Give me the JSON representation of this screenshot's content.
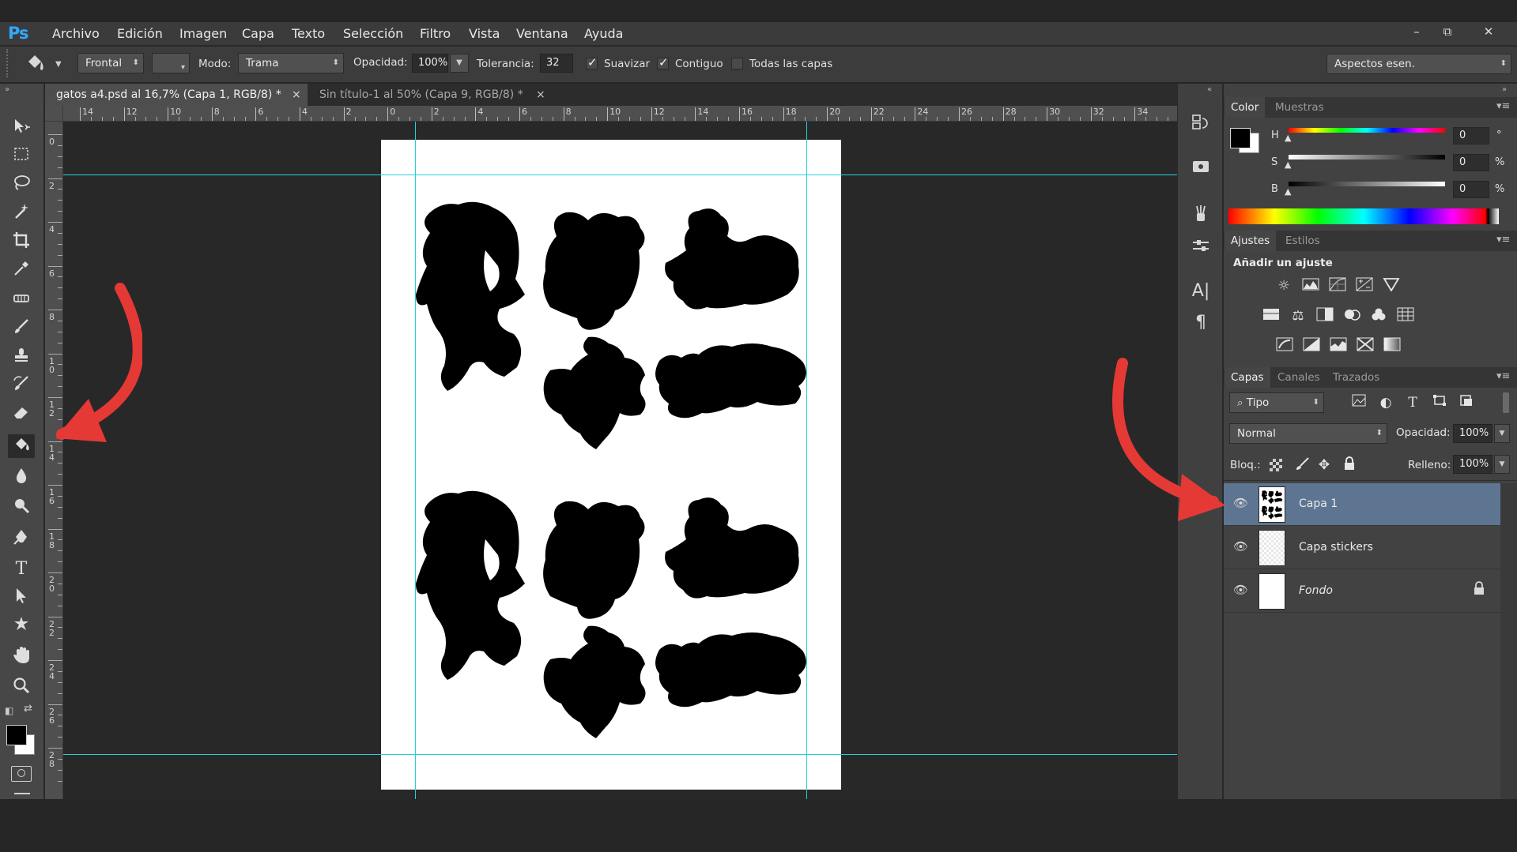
{
  "app": {
    "logo": "Ps"
  },
  "menu": [
    "Archivo",
    "Edición",
    "Imagen",
    "Capa",
    "Texto",
    "Selección",
    "Filtro",
    "Vista",
    "Ventana",
    "Ayuda"
  ],
  "window_controls": {
    "minimize": "–",
    "restore": "⧉",
    "close": "✕"
  },
  "options": {
    "fill_source": "Frontal",
    "pattern": "",
    "mode_label": "Modo:",
    "mode": "Trama",
    "opacity_label": "Opacidad:",
    "opacity": "100%",
    "tolerance_label": "Tolerancia:",
    "tolerance": "32",
    "smooth_label": "Suavizar",
    "smooth_checked": true,
    "contiguous_label": "Contiguo",
    "contiguous_checked": true,
    "all_layers_label": "Todas las capas",
    "all_layers_checked": false,
    "workspace": "Aspectos esen."
  },
  "tabs": [
    {
      "label": "gatos a4.psd al 16,7% (Capa 1, RGB/8) *",
      "close": "×",
      "active": true
    },
    {
      "label": "Sin título-1 al 50% (Capa 9, RGB/8) *",
      "close": "×",
      "active": false
    }
  ],
  "ruler_top": [
    "14",
    "12",
    "10",
    "8",
    "6",
    "4",
    "2",
    "0",
    "2",
    "4",
    "6",
    "8",
    "10",
    "12",
    "14",
    "16",
    "18",
    "20",
    "22",
    "24",
    "26",
    "28",
    "30",
    "32",
    "34"
  ],
  "ruler_left": [
    "0",
    "2",
    "4",
    "6",
    "8",
    "1\n0",
    "1\n2",
    "1\n4",
    "1\n6",
    "1\n8",
    "2\n0",
    "2\n2",
    "2\n4",
    "2\n6",
    "2\n8"
  ],
  "tools": [
    "move-tool",
    "marquee-tool",
    "lasso-tool",
    "magic-wand-tool",
    "crop-tool",
    "eyedropper-tool",
    "healing-tool",
    "brush-tool",
    "stamp-tool",
    "history-brush-tool",
    "eraser-tool",
    "paint-bucket-tool",
    "blur-tool",
    "dodge-tool",
    "pen-tool",
    "type-tool",
    "path-selection-tool",
    "custom-shape-tool",
    "hand-tool",
    "zoom-tool"
  ],
  "color_panel": {
    "tabs": [
      "Color",
      "Muestras"
    ],
    "h_label": "H",
    "h_value": "0",
    "h_unit": "°",
    "s_label": "S",
    "s_value": "0",
    "s_unit": "%",
    "b_label": "B",
    "b_value": "0",
    "b_unit": "%"
  },
  "adjustments_panel": {
    "tabs": [
      "Ajustes",
      "Estilos"
    ],
    "title": "Añadir un ajuste"
  },
  "layers_panel": {
    "tabs": [
      "Capas",
      "Canales",
      "Trazados"
    ],
    "filter": "Tipo",
    "blend_mode": "Normal",
    "opacity_label": "Opacidad:",
    "opacity": "100%",
    "lock_label": "Bloq.:",
    "fill_label": "Relleno:",
    "fill": "100%",
    "layers": [
      {
        "name": "Capa 1",
        "selected": true,
        "locked": false
      },
      {
        "name": "Capa stickers",
        "selected": false,
        "locked": false
      },
      {
        "name": "Fondo",
        "selected": false,
        "locked": true
      }
    ]
  },
  "colors": {
    "accent_guide": "#25d2d6",
    "annotation_arrow": "#e53935",
    "selected_layer": "#5e7591",
    "ps_blue": "#31a8ff"
  }
}
